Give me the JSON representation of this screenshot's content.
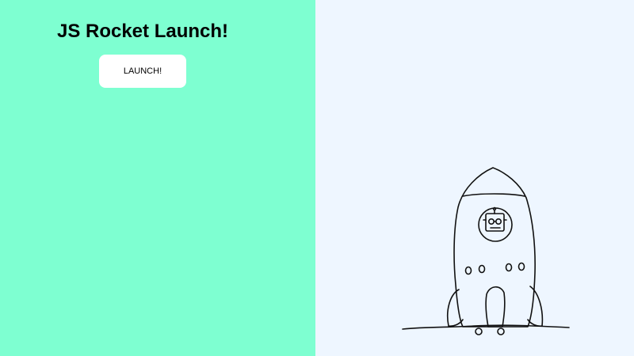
{
  "page": {
    "title": "JS Rocket Launch!"
  },
  "controls": {
    "launch_label": "LAUNCH!"
  },
  "colors": {
    "left_panel_bg": "#7effd1",
    "right_panel_bg": "#eef6ff",
    "button_bg": "#ffffff",
    "line_color": "#111111"
  },
  "illustration": {
    "subject": "rocket-with-robot-pilot"
  }
}
